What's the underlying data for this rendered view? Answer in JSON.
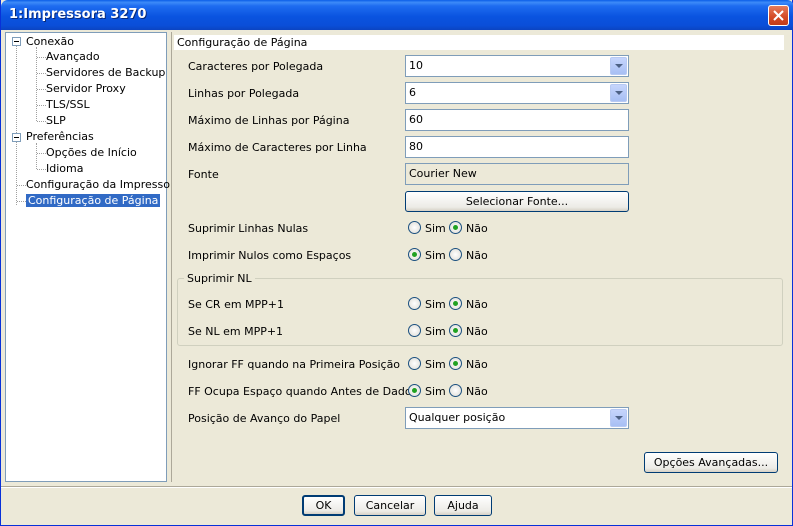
{
  "window": {
    "title": "1:Impressora 3270"
  },
  "tree": {
    "items": [
      {
        "label": "Conexão",
        "level": 0,
        "expandable": true
      },
      {
        "label": "Avançado",
        "level": 1
      },
      {
        "label": "Servidores de Backup",
        "level": 1
      },
      {
        "label": "Servidor Proxy",
        "level": 1
      },
      {
        "label": "TLS/SSL",
        "level": 1
      },
      {
        "label": "SLP",
        "level": 1
      },
      {
        "label": "Preferências",
        "level": 0,
        "expandable": true
      },
      {
        "label": "Opções de Início",
        "level": 1
      },
      {
        "label": "Idioma",
        "level": 1
      },
      {
        "label": "Configuração da Impressora",
        "level": 0
      },
      {
        "label": "Configuração de Página",
        "level": 0,
        "selected": true
      }
    ]
  },
  "panel": {
    "header": "Configuração de Página",
    "cpp_label": "Caracteres por Polegada",
    "cpp_value": "10",
    "lpp_label": "Linhas por Polegada",
    "lpp_value": "6",
    "max_lines_label": "Máximo de Linhas por Página",
    "max_lines_value": "60",
    "max_chars_label": "Máximo de Caracteres por Linha",
    "max_chars_value": "80",
    "font_label": "Fonte",
    "font_value": "Courier New",
    "select_font_button": "Selecionar Fonte...",
    "suppress_null_lines_label": "Suprimir Linhas Nulas",
    "print_nulls_label": "Imprimir Nulos como Espaços",
    "suppress_nl_group": "Suprimir NL",
    "cr_mpp_label": "Se CR em MPP+1",
    "nl_mpp_label": "Se NL em MPP+1",
    "ignore_ff_label": "Ignorar FF quando na Primeira Posição",
    "ff_space_label": "FF Ocupa Espaço quando Antes de Dados",
    "paper_advance_label": "Posição de Avanço do Papel",
    "paper_advance_value": "Qualquer posição",
    "advanced_button": "Opções Avançadas...",
    "yes": "Sim",
    "no": "Não",
    "radios": {
      "suppress_null_lines": "no",
      "print_nulls": "yes",
      "cr_mpp": "no",
      "nl_mpp": "no",
      "ignore_ff": "no",
      "ff_space": "yes"
    }
  },
  "footer": {
    "ok": "OK",
    "cancel": "Cancelar",
    "help": "Ajuda"
  }
}
